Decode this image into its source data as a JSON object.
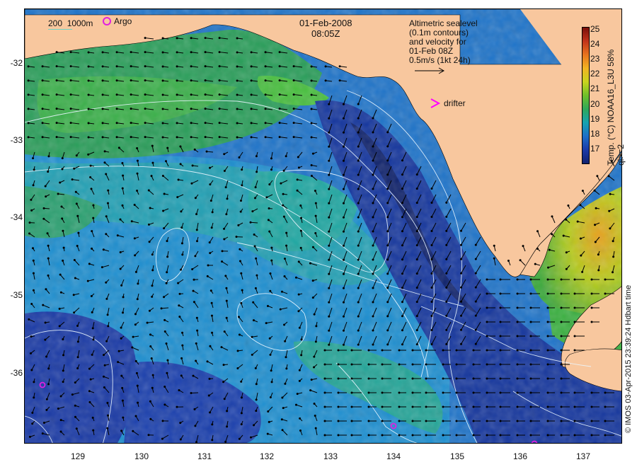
{
  "date": "01-Feb-2008",
  "time": "08:05Z",
  "bathymetry_legend": {
    "shallow": "200",
    "deep": "1000m"
  },
  "argo_label": "Argo",
  "drifter_label": "drifter",
  "altimetry_note": [
    "Altimetric sealevel",
    "(0.1m contours)",
    "and velocity for",
    "01-Feb 08Z",
    "0.5m/s (1kt 24h)"
  ],
  "colorbar": {
    "title": "Temp. (°C) NOAA16_L3U 58% ql>=2",
    "ticks": [
      "25",
      "24",
      "23",
      "22",
      "21",
      "20",
      "19",
      "18",
      "17"
    ]
  },
  "credit": "© IMOS 03-Apr-2015 23:39:24 Hdbart time",
  "axes": {
    "lat_ticks": [
      "-32",
      "-33",
      "-34",
      "-35",
      "-36"
    ],
    "lon_ticks": [
      "129",
      "130",
      "131",
      "132",
      "133",
      "134",
      "135",
      "136",
      "137"
    ]
  },
  "colors": {
    "land": "#f8c79e",
    "sst_cold": "#12226e",
    "sst_cool": "#1e6fc8",
    "sst_mid": "#18a3b0",
    "sst_warm": "#2fa85a",
    "sst_hot": "#f2b422",
    "contour": "#e8f4ff",
    "argo_marker": "#e020e0",
    "drifter_marker": "#ff00ff"
  }
}
